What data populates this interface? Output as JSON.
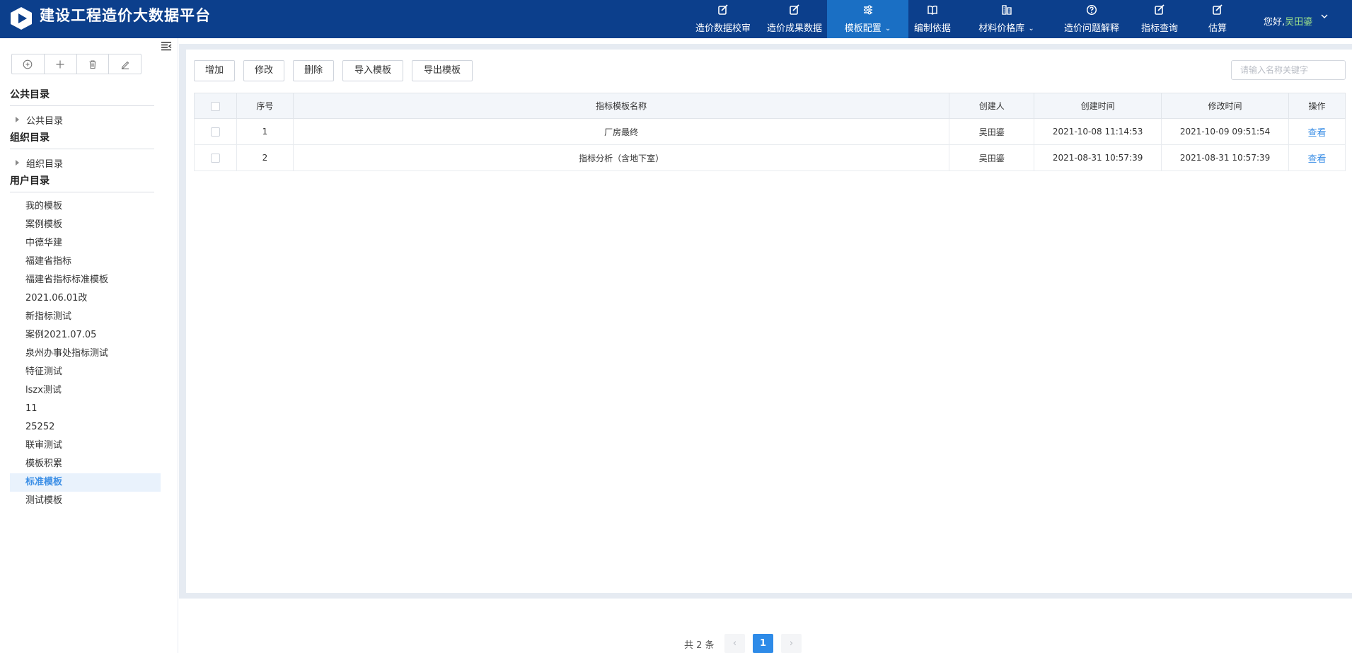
{
  "header": {
    "title": "建设工程造价大数据平台",
    "greeting_prefix": "您好,",
    "user_name": "吴田鎏",
    "brand_color": "#0c3f8c",
    "active_color": "#1a6fc4",
    "nav": [
      {
        "label": "造价数据校审",
        "icon": "edit-check-icon",
        "has_dropdown": false,
        "active": false
      },
      {
        "label": "造价成果数据",
        "icon": "edit-check-icon",
        "has_dropdown": false,
        "active": false
      },
      {
        "label": "模板配置",
        "icon": "sliders-icon",
        "has_dropdown": true,
        "active": true
      },
      {
        "label": "编制依据",
        "icon": "book-icon",
        "has_dropdown": false,
        "active": false
      },
      {
        "label": "材料价格库",
        "icon": "building-icon",
        "has_dropdown": true,
        "active": false
      },
      {
        "label": "造价问题解释",
        "icon": "question-circle-icon",
        "has_dropdown": false,
        "active": false
      },
      {
        "label": "指标查询",
        "icon": "edit-check-icon",
        "has_dropdown": false,
        "active": false
      },
      {
        "label": "估算",
        "icon": "edit-check-icon",
        "has_dropdown": false,
        "active": false
      }
    ]
  },
  "sidebar": {
    "tools": [
      "add-circle-icon",
      "plus-icon",
      "trash-icon",
      "pen-icon"
    ],
    "public_title": "公共目录",
    "public_node": "公共目录",
    "org_title": "组织目录",
    "org_node": "组织目录",
    "user_title": "用户目录",
    "user_items": [
      "我的模板",
      "案例模板",
      "中德华建",
      "福建省指标",
      "福建省指标标准模板",
      "2021.06.01改",
      "新指标测试",
      "案例2021.07.05",
      "泉州办事处指标测试",
      "特征测试",
      "lszx测试",
      "11",
      "25252",
      "联审测试",
      "模板积累",
      "标准模板",
      "测试模板"
    ],
    "selected_index": 15
  },
  "toolbar": {
    "add": "增加",
    "edit": "修改",
    "delete": "删除",
    "import": "导入模板",
    "export": "导出模板",
    "search_placeholder": "请输入名称关键字"
  },
  "table": {
    "columns": [
      "序号",
      "指标模板名称",
      "创建人",
      "创建时间",
      "修改时间",
      "操作"
    ],
    "rows": [
      {
        "no": "1",
        "name": "厂房最终",
        "creator": "吴田鎏",
        "created": "2021-10-08 11:14:53",
        "modified": "2021-10-09 09:51:54",
        "action": "查看"
      },
      {
        "no": "2",
        "name": "指标分析（含地下室）",
        "creator": "吴田鎏",
        "created": "2021-08-31 10:57:39",
        "modified": "2021-08-31 10:57:39",
        "action": "查看"
      }
    ]
  },
  "pager": {
    "total_text": "共 2 条",
    "current": "1",
    "prev": "‹",
    "next": "›"
  }
}
